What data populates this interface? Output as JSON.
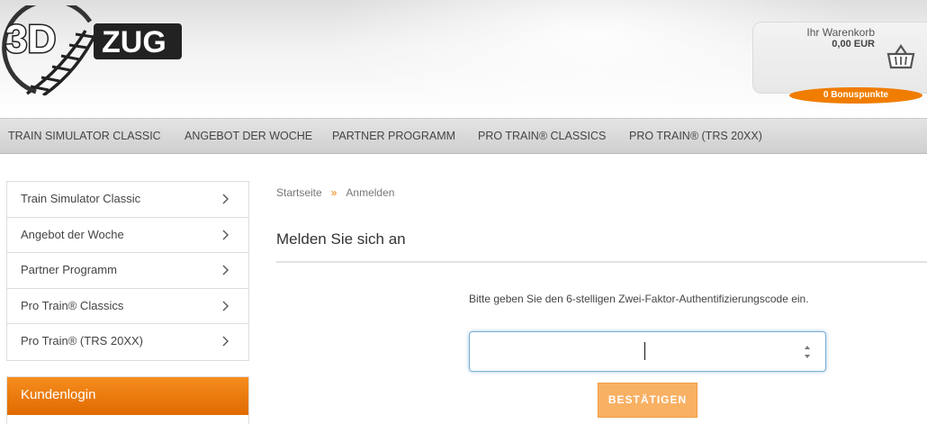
{
  "logo": {
    "brand_text": "3D ZUG"
  },
  "cart": {
    "label": "Ihr Warenkorb",
    "amount": "0,00 EUR",
    "bonus": "0 Bonuspunkte",
    "icon": "basket-icon"
  },
  "nav": {
    "items": [
      {
        "label": "TRAIN SIMULATOR CLASSIC"
      },
      {
        "label": "ANGEBOT DER WOCHE"
      },
      {
        "label": "PARTNER PROGRAMM"
      },
      {
        "label": "PRO TRAIN® CLASSICS"
      },
      {
        "label": "PRO TRAIN® (TRS 20XX)"
      }
    ]
  },
  "sidebar": {
    "items": [
      {
        "label": "Train Simulator Classic"
      },
      {
        "label": "Angebot der Woche"
      },
      {
        "label": "Partner Programm"
      },
      {
        "label": "Pro Train® Classics"
      },
      {
        "label": "Pro Train® (TRS 20XX)"
      }
    ],
    "login_title": "Kundenlogin"
  },
  "breadcrumb": {
    "home": "Startseite",
    "separator": "»",
    "current": "Anmelden"
  },
  "main": {
    "title": "Melden Sie sich an",
    "instruction": "Bitte geben Sie den 6-stelligen Zwei-Faktor-Authentifizierungscode ein.",
    "code_value": "",
    "confirm_label": "BESTÄTIGEN"
  },
  "colors": {
    "accent": "#f07d00",
    "button": "#f8b063",
    "input_focus": "#7ab0d6"
  }
}
